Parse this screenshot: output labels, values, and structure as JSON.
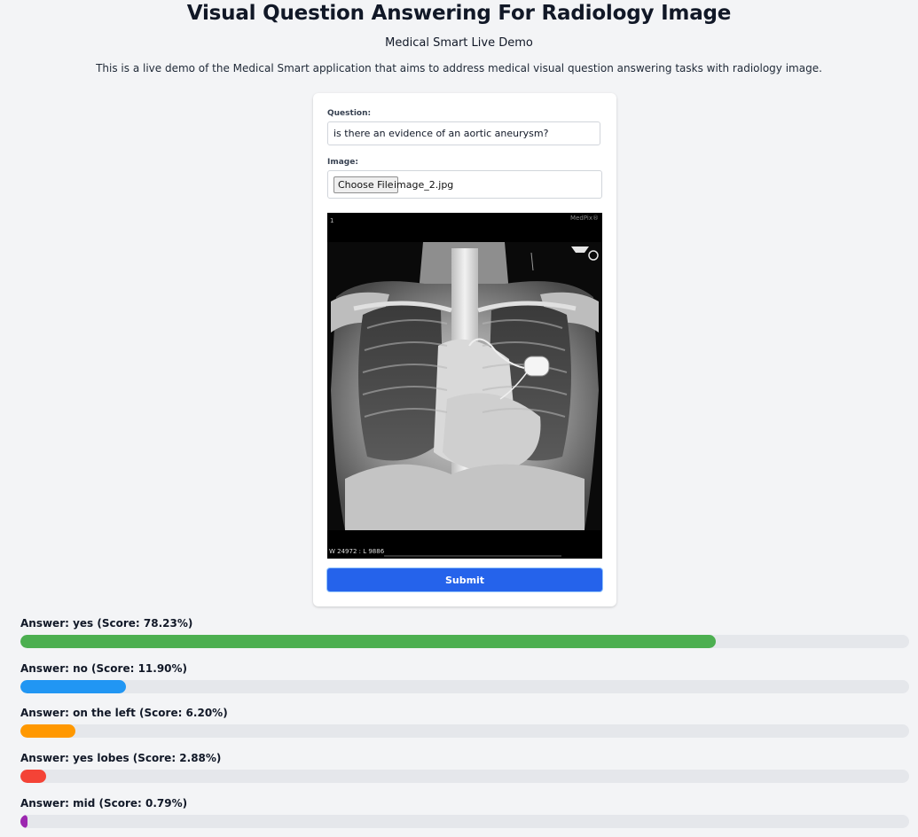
{
  "header": {
    "title": "Visual Question Answering For Radiology Image",
    "subtitle": "Medical Smart Live Demo",
    "description": "This is a live demo of the Medical Smart application that aims to address medical visual question answering tasks with radiology image."
  },
  "form": {
    "question_label": "Question:",
    "question_value": "is there an evidence of an aortic aneurysm?",
    "image_label": "Image:",
    "choose_file_label": "Choose File",
    "file_name": "image_2.jpg",
    "image_overlay": {
      "top_left": "1",
      "top_right": "MedPix®",
      "bottom_left": "W 24972 : L 9886"
    },
    "submit_label": "Submit"
  },
  "answers": [
    {
      "label": "Answer: yes (Score: 78.23%)",
      "score": 78.23,
      "color": "#4caf50"
    },
    {
      "label": "Answer: no (Score: 11.90%)",
      "score": 11.9,
      "color": "#2196f3"
    },
    {
      "label": "Answer: on the left (Score: 6.20%)",
      "score": 6.2,
      "color": "#ff9800"
    },
    {
      "label": "Answer: yes lobes (Score: 2.88%)",
      "score": 2.88,
      "color": "#f44336"
    },
    {
      "label": "Answer: mid (Score: 0.79%)",
      "score": 0.79,
      "color": "#9c27b0"
    }
  ]
}
